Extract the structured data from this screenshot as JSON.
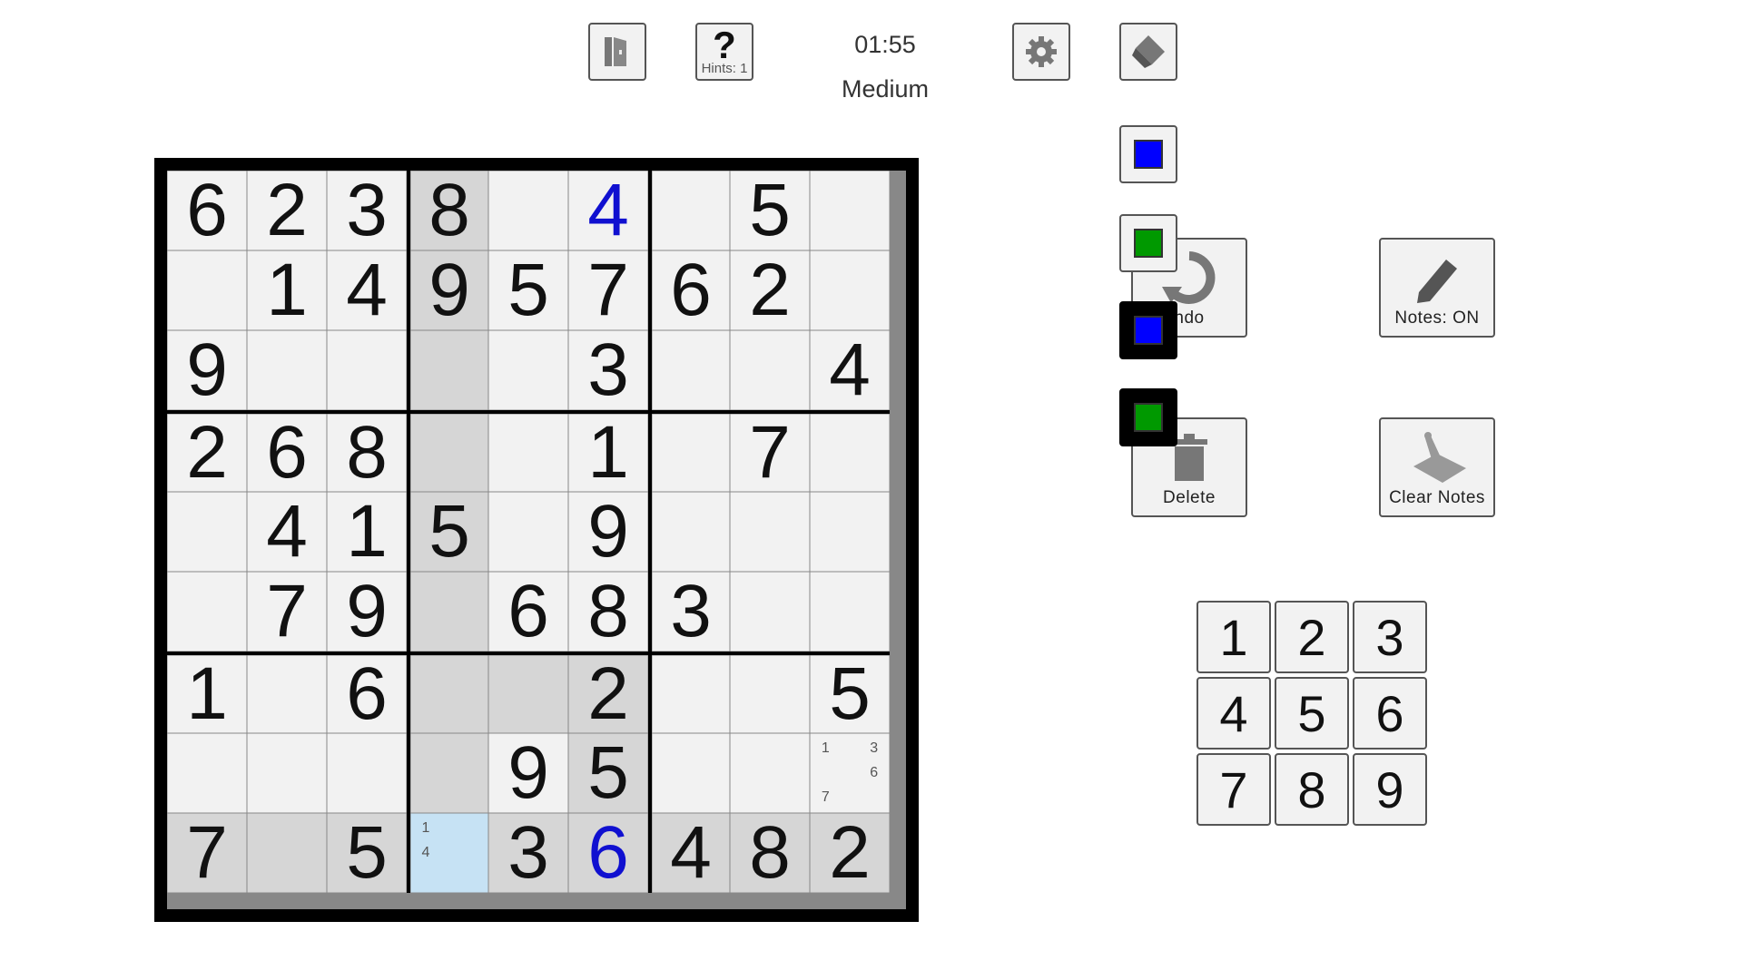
{
  "header": {
    "hint_symbol": "?",
    "hints_label": "Hints: 1",
    "timer": "01:55",
    "difficulty": "Medium"
  },
  "colors": {
    "cell_bg": "#f2f2f2",
    "highlight": "#d6d6d6",
    "selected": "#c6e2f4",
    "user_digit": "#1010d0",
    "palette_blue": "#0000ff",
    "palette_green": "#009900",
    "palette_active_border": "#f2f200"
  },
  "board": {
    "rows": [
      [
        "6",
        "2",
        "3",
        "8",
        "",
        "4",
        "",
        "5",
        ""
      ],
      [
        "",
        "1",
        "4",
        "9",
        "5",
        "7",
        "6",
        "2",
        ""
      ],
      [
        "9",
        "",
        "",
        "",
        "",
        "3",
        "",
        "",
        "4"
      ],
      [
        "2",
        "6",
        "8",
        "",
        "",
        "1",
        "",
        "7",
        ""
      ],
      [
        "",
        "4",
        "1",
        "5",
        "",
        "9",
        "",
        "",
        ""
      ],
      [
        "",
        "7",
        "9",
        "",
        "6",
        "8",
        "3",
        "",
        ""
      ],
      [
        "1",
        "",
        "6",
        "",
        "",
        "2",
        "",
        "",
        "5"
      ],
      [
        "",
        "",
        "",
        "",
        "9",
        "5",
        "",
        "",
        ""
      ],
      [
        "7",
        "",
        "5",
        "",
        "3",
        "6",
        "4",
        "8",
        "2"
      ]
    ],
    "user_cells": [
      [
        0,
        5
      ],
      [
        8,
        5
      ]
    ],
    "selected": [
      8,
      3
    ],
    "highlighted": [
      [
        0,
        3
      ],
      [
        1,
        3
      ],
      [
        2,
        3
      ],
      [
        3,
        3
      ],
      [
        4,
        3
      ],
      [
        5,
        3
      ],
      [
        6,
        3
      ],
      [
        7,
        3
      ],
      [
        6,
        4
      ],
      [
        6,
        5
      ],
      [
        7,
        5
      ],
      [
        8,
        0
      ],
      [
        8,
        1
      ],
      [
        8,
        2
      ],
      [
        8,
        4
      ],
      [
        8,
        5
      ],
      [
        8,
        6
      ],
      [
        8,
        7
      ],
      [
        8,
        8
      ]
    ],
    "notes": [
      {
        "cell": [
          7,
          8
        ],
        "values": [
          "1",
          "",
          "3",
          "",
          "",
          "6",
          "7",
          "",
          ""
        ]
      },
      {
        "cell": [
          8,
          3
        ],
        "values": [
          "1",
          "",
          "",
          "4",
          "",
          "",
          "",
          "",
          ""
        ]
      }
    ]
  },
  "palette": [
    {
      "name": "blue",
      "color": "#0000ff",
      "active": true,
      "dark": false
    },
    {
      "name": "green",
      "color": "#009900",
      "active": false,
      "dark": false
    },
    {
      "name": "blue",
      "color": "#0000ff",
      "active": false,
      "dark": true
    },
    {
      "name": "green",
      "color": "#009900",
      "active": false,
      "dark": true
    }
  ],
  "actions": {
    "undo_label": "ndo",
    "notes_label": "Notes: ON",
    "delete_label": "Delete",
    "clear_notes_label": "Clear Notes"
  },
  "numpad": [
    "1",
    "2",
    "3",
    "4",
    "5",
    "6",
    "7",
    "8",
    "9"
  ],
  "icons": {
    "exit": "exit-door-icon",
    "settings": "gear-icon",
    "eraser": "eraser-icon",
    "undo": "undo-icon",
    "notes": "pencil-icon",
    "delete": "trash-icon",
    "clear_notes": "clear-notes-icon"
  }
}
